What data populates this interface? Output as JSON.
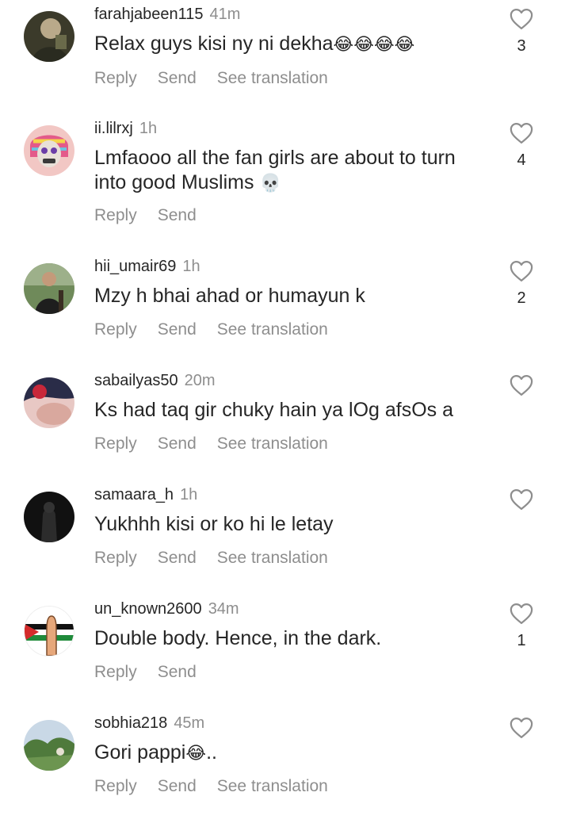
{
  "comments": [
    {
      "username": "farahjabeen115",
      "time": "41m",
      "text": "Relax guys kisi ny ni dekha",
      "emoji": "😂😂😂😂",
      "likes": "3",
      "actions": [
        "Reply",
        "Send",
        "See translation"
      ]
    },
    {
      "username": "ii.lilrxj",
      "time": "1h",
      "text": "Lmfaooo all the fan girls are about to turn into good Muslims",
      "emoji": "💀",
      "likes": "4",
      "actions": [
        "Reply",
        "Send"
      ]
    },
    {
      "username": "hii_umair69",
      "time": "1h",
      "text": "Mzy h bhai ahad or humayun k",
      "emoji": "",
      "likes": "2",
      "actions": [
        "Reply",
        "Send",
        "See translation"
      ]
    },
    {
      "username": "sabailyas50",
      "time": "20m",
      "text": "Ks had taq gir chuky hain ya lOg afsOs a",
      "emoji": "",
      "likes": "",
      "actions": [
        "Reply",
        "Send",
        "See translation"
      ]
    },
    {
      "username": "samaara_h",
      "time": "1h",
      "text": "Yukhhh kisi or ko hi le letay",
      "emoji": "",
      "likes": "",
      "actions": [
        "Reply",
        "Send",
        "See translation"
      ]
    },
    {
      "username": "un_known2600",
      "time": "34m",
      "text": "Double body. Hence, in the dark.",
      "emoji": "",
      "likes": "1",
      "actions": [
        "Reply",
        "Send"
      ]
    },
    {
      "username": "sobhia218",
      "time": "45m",
      "text": "Gori pappi",
      "emoji": "😂",
      "text_suffix": "..",
      "likes": "",
      "actions": [
        "Reply",
        "Send",
        "See translation"
      ]
    }
  ],
  "colors": {
    "text": "#262626",
    "secondary": "#8e8e8e",
    "background": "#ffffff"
  },
  "icons": {
    "like": "heart-outline-icon"
  }
}
